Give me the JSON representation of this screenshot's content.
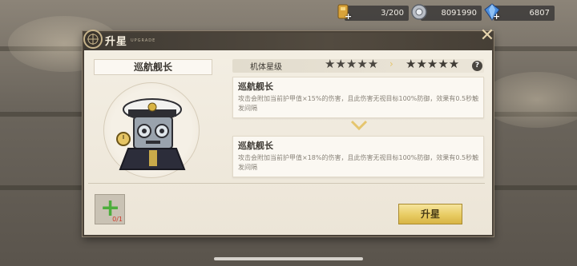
{
  "resources": [
    {
      "icon": "fuel-icon",
      "value": "3/200"
    },
    {
      "icon": "gear-coin-icon",
      "value": "8091990"
    },
    {
      "icon": "crystal-icon",
      "value": "6807"
    }
  ],
  "panel": {
    "title": "升星",
    "subtitle": "UPGRADE",
    "close_icon": "close-icon"
  },
  "unit": {
    "name": "巡航舰长"
  },
  "star_level": {
    "label": "机体星级",
    "current_stars": "★★★★★",
    "next_stars": "★★★★★",
    "help": "?"
  },
  "skills": [
    {
      "name": "巡航舰长",
      "desc": "攻击会附加当前护甲值×15%的伤害，且此伤害无视目标100%防御，效果有0.5秒触发间隔"
    },
    {
      "name": "巡航舰长",
      "desc": "攻击会附加当前护甲值×18%的伤害，且此伤害无视目标100%防御，效果有0.5秒触发间隔"
    }
  ],
  "material": {
    "count": "0/1"
  },
  "actions": {
    "upgrade_label": "升星"
  },
  "colors": {
    "accent_gold": "#e8cc63",
    "header_dark": "#3f3a33",
    "panel_bg": "#f4efe4",
    "material_count_red": "#d03c2c"
  }
}
